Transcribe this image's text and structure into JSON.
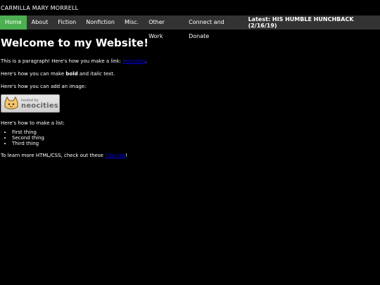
{
  "header": {
    "site_title": "CARMILLA MARY MORRELL"
  },
  "nav": {
    "items": [
      "Home",
      "About",
      "Fiction",
      "Nonfiction",
      "Misc.",
      "Other Work",
      "Connect and Donate"
    ],
    "latest": "Latest: HIS HUMBLE HUNCHBACK (2/16/19)",
    "active_color": "#4caf50"
  },
  "main": {
    "heading": "Welcome to my Website!",
    "p1_text": "This is a paragraph! Here's how you make a link: ",
    "p1_link": "Neocities",
    "p1_end": ".",
    "p2_a": "Here's how you can make ",
    "p2_bold": "bold",
    "p2_b": " and ",
    "p2_italic": "italic",
    "p2_c": " text.",
    "p3": "Here's how you can add an image:",
    "badge_small": "hosted by",
    "badge_big": "neocities",
    "p4": "Here's how to make a list:",
    "list": [
      "First thing",
      "Second thing",
      "Third thing"
    ],
    "p5_text": "To learn more HTML/CSS, check out these ",
    "p5_link": "tutorials",
    "p5_end": "!"
  }
}
